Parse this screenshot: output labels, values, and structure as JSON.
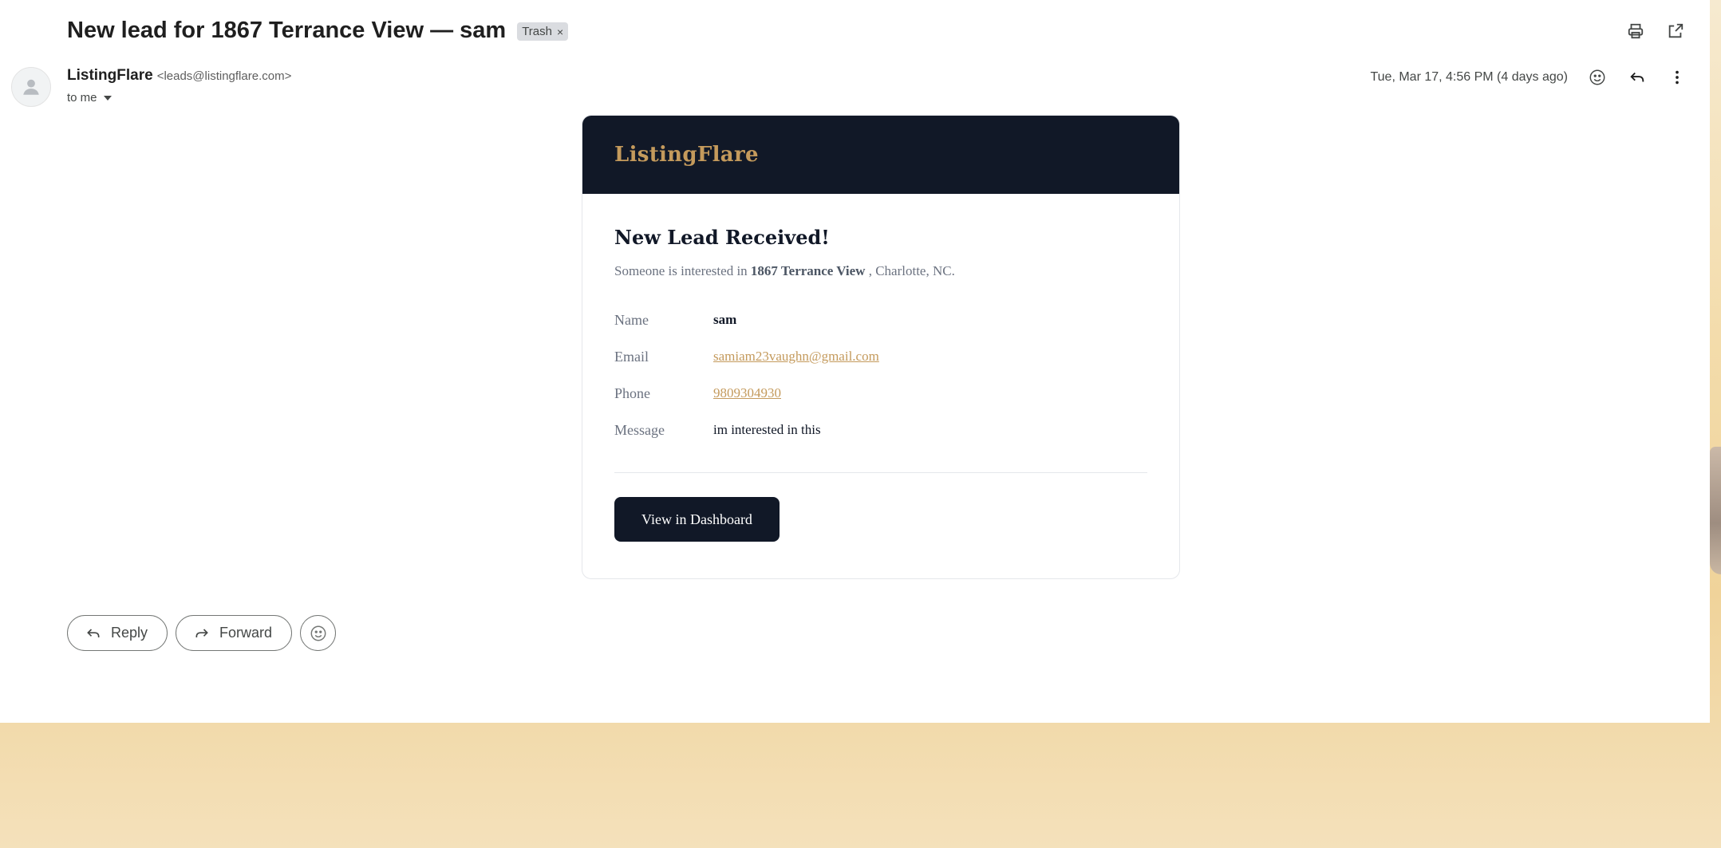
{
  "email": {
    "subject": "New lead for 1867 Terrance View — sam",
    "label": "Trash",
    "label_remove": "×",
    "sender_name": "ListingFlare",
    "sender_email": "<leads@listingflare.com>",
    "recipient": "to me",
    "date": "Tue, Mar 17, 4:56 PM (4 days ago)"
  },
  "card": {
    "brand": "ListingFlare",
    "title": "New Lead Received!",
    "intro_prefix": "Someone is interested in",
    "property": "1867 Terrance View",
    "intro_suffix": ", Charlotte, NC.",
    "fields": [
      {
        "label": "Name",
        "value": "sam"
      },
      {
        "label": "Email",
        "value": "samiam23vaughn@gmail.com"
      },
      {
        "label": "Phone",
        "value": "9809304930"
      },
      {
        "label": "Message",
        "value": "im interested in this"
      }
    ],
    "button": "View in Dashboard",
    "colors": {
      "header_bg": "#111827",
      "accent": "#c49a5c"
    }
  },
  "actions": {
    "reply": "Reply",
    "forward": "Forward"
  },
  "icons": {
    "print": "printer-icon",
    "popout": "open-in-new-window-icon",
    "emoji": "emoji-icon",
    "reply": "reply-icon",
    "more": "more-vertical-icon",
    "dropdown": "caret-down-icon",
    "avatar": "default-avatar-icon"
  }
}
